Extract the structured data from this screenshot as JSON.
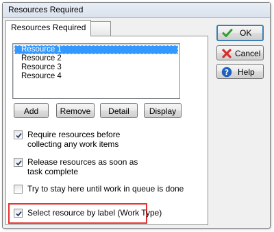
{
  "window": {
    "title": "Resources Required"
  },
  "tabs": [
    {
      "label": "Resources Required",
      "active": true
    },
    {
      "label": "",
      "active": false
    }
  ],
  "resources": {
    "items": [
      {
        "label": "Resource 1",
        "selected": true
      },
      {
        "label": "Resource 2",
        "selected": false
      },
      {
        "label": "Resource 3",
        "selected": false
      },
      {
        "label": "Resource 4",
        "selected": false
      }
    ]
  },
  "list_buttons": {
    "add": "Add",
    "remove": "Remove",
    "detail": "Detail",
    "display": "Display"
  },
  "options": [
    {
      "line1": "Require resources before",
      "line2": "collecting any work items",
      "checked": true
    },
    {
      "line1": "Release resources as soon as",
      "line2": "task complete",
      "checked": true
    },
    {
      "line1": "Try to stay here until work in queue is done",
      "line2": "",
      "checked": false
    },
    {
      "line1": "Select resource by label (Work Type)",
      "line2": "",
      "checked": true,
      "highlighted": true
    }
  ],
  "side_buttons": {
    "ok": "OK",
    "cancel": "Cancel",
    "help": "Help"
  },
  "colors": {
    "selection": "#3399ff",
    "highlight_border": "#e3342f",
    "ok_check": "#2e9e2e",
    "cancel_x": "#d0312d",
    "help_circle": "#1f5fbf"
  },
  "icons": {
    "ok": "green-check-icon",
    "cancel": "red-x-icon",
    "help": "blue-question-icon"
  }
}
